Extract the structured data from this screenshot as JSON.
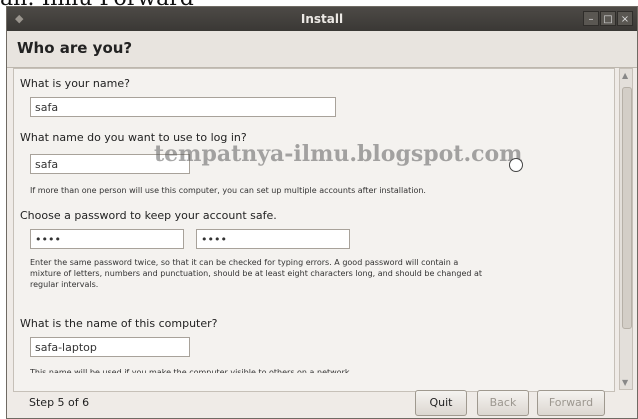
{
  "caption": "an: Ilmu Forward",
  "window": {
    "title": "Install",
    "controls": {
      "minimize": "–",
      "maximize": "□",
      "close": "×"
    }
  },
  "header": {
    "title": "Who are you?"
  },
  "form": {
    "name_label": "What is your name?",
    "name_value": "safa",
    "login_label": "What name do you want to use to log in?",
    "login_value": "safa",
    "login_hint": "If more than one person will use this computer, you can set up multiple accounts after installation.",
    "password_label": "Choose a password to keep your account safe.",
    "password_value": "••••",
    "password_confirm_value": "••••",
    "password_hint_lines": [
      "Enter the same password twice, so that it can be checked for typing errors. A good password will contain a",
      "mixture of letters, numbers and punctuation, should be at least eight characters long, and should be changed at",
      "regular intervals."
    ],
    "computer_label": "What is the name of this computer?",
    "computer_value": "safa-laptop",
    "computer_hint": "This name will be used if you make the computer visible to others on a network."
  },
  "watermark": "tempatnya-ilmu.blogspot.com",
  "footer": {
    "step": "Step 5 of 6",
    "quit": "Quit",
    "back": "Back",
    "forward": "Forward"
  },
  "colors": {
    "titlebar": "#3f3c39",
    "window_bg": "#efebe7",
    "content_bg": "#f4f2ef",
    "field_border": "#a8a29a"
  }
}
